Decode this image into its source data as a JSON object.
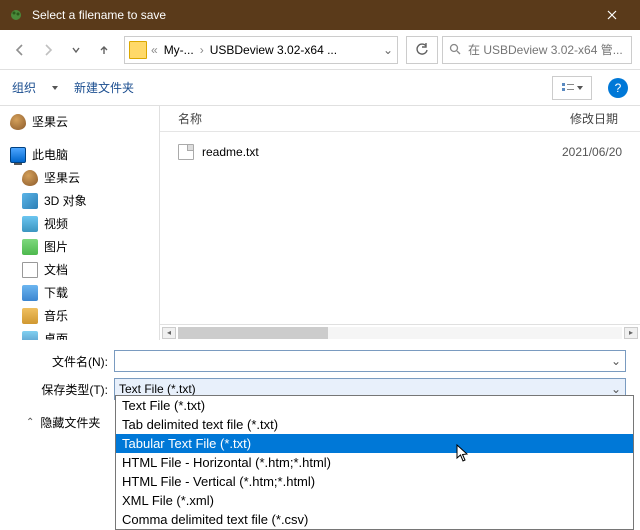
{
  "titlebar": {
    "title": "Select a filename to save"
  },
  "nav": {
    "crumb1": "My-...",
    "crumb2": "USBDeview 3.02-x64 ...",
    "search_placeholder": "在 USBDeview 3.02-x64 管..."
  },
  "toolbar": {
    "organize": "组织",
    "newfolder": "新建文件夹"
  },
  "tree": [
    {
      "icon": "nut",
      "label": "坚果云"
    },
    {
      "icon": "pc",
      "label": "此电脑"
    },
    {
      "icon": "nut",
      "label": "坚果云",
      "indent": true
    },
    {
      "icon": "cube",
      "label": "3D 对象",
      "indent": true
    },
    {
      "icon": "vid",
      "label": "视频",
      "indent": true
    },
    {
      "icon": "pic",
      "label": "图片",
      "indent": true
    },
    {
      "icon": "doc",
      "label": "文档",
      "indent": true
    },
    {
      "icon": "dl",
      "label": "下载",
      "indent": true
    },
    {
      "icon": "mus",
      "label": "音乐",
      "indent": true
    },
    {
      "icon": "desk",
      "label": "桌面",
      "indent": true
    }
  ],
  "columns": {
    "name": "名称",
    "date": "修改日期"
  },
  "files": [
    {
      "name": "readme.txt",
      "date": "2021/06/20"
    }
  ],
  "form": {
    "filename_label": "文件名(N):",
    "filetype_label": "保存类型(T):",
    "filetype_value": "Text File (*.txt)",
    "hide_label": "隐藏文件夹"
  },
  "dropdown": {
    "selected_index": 2,
    "options": [
      "Text File (*.txt)",
      "Tab delimited text file (*.txt)",
      "Tabular Text File (*.txt)",
      "HTML File - Horizontal (*.htm;*.html)",
      "HTML File - Vertical (*.htm;*.html)",
      "XML File (*.xml)",
      "Comma delimited text file (*.csv)"
    ]
  },
  "help_glyph": "?"
}
